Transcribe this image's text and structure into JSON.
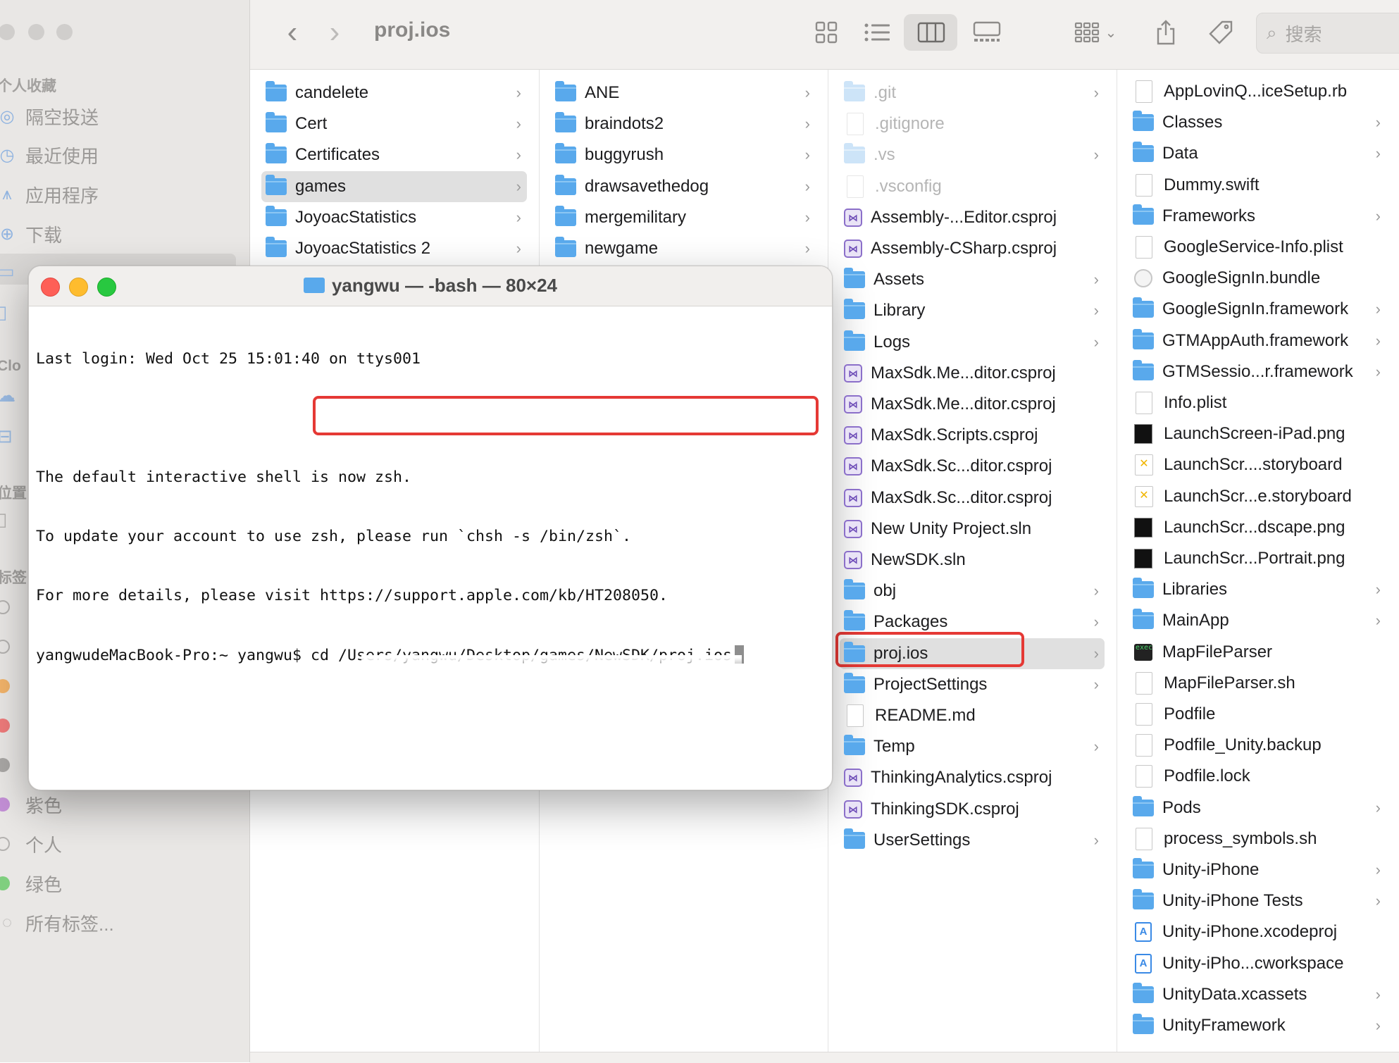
{
  "sidebar": {
    "favorites_header": "个人收藏",
    "favorites": [
      {
        "label": "隔空投送",
        "icon": "airdrop-icon"
      },
      {
        "label": "最近使用",
        "icon": "clock-icon"
      },
      {
        "label": "应用程序",
        "icon": "apps-icon"
      },
      {
        "label": "下载",
        "icon": "download-icon"
      }
    ],
    "icloud_header": "Clo",
    "locations_header": "位置",
    "tags_header": "标签",
    "tags": [
      {
        "label": "紫色",
        "color": "#c38fd6"
      },
      {
        "label": "个人",
        "color": ""
      },
      {
        "label": "绿色",
        "color": "#7fcf7f"
      },
      {
        "label": "所有标签...",
        "color": ""
      }
    ]
  },
  "toolbar": {
    "title": "proj.ios",
    "back": "‹",
    "forward": "›",
    "search_placeholder": "搜索"
  },
  "columns": [
    {
      "items": [
        {
          "name": "candelete",
          "type": "folder",
          "chevron": true
        },
        {
          "name": "Cert",
          "type": "folder",
          "chevron": true
        },
        {
          "name": "Certificates",
          "type": "folder",
          "chevron": true
        },
        {
          "name": "games",
          "type": "folder",
          "chevron": true,
          "selected": true
        },
        {
          "name": "JoyoacStatistics",
          "type": "folder",
          "chevron": true
        },
        {
          "name": "JoyoacStatistics 2",
          "type": "folder",
          "chevron": true
        }
      ]
    },
    {
      "items": [
        {
          "name": "ANE",
          "type": "folder",
          "chevron": true
        },
        {
          "name": "braindots2",
          "type": "folder",
          "chevron": true
        },
        {
          "name": "buggyrush",
          "type": "folder",
          "chevron": true
        },
        {
          "name": "drawsavethedog",
          "type": "folder",
          "chevron": true
        },
        {
          "name": "mergemilitary",
          "type": "folder",
          "chevron": true
        },
        {
          "name": "newgame",
          "type": "folder",
          "chevron": true
        }
      ]
    },
    {
      "items": [
        {
          "name": ".git",
          "type": "folder-faded",
          "chevron": true
        },
        {
          "name": ".gitignore",
          "type": "doc-faded",
          "chevron": false
        },
        {
          "name": ".vs",
          "type": "folder-faded",
          "chevron": true
        },
        {
          "name": ".vsconfig",
          "type": "doc-faded",
          "chevron": false
        },
        {
          "name": "Assembly-...Editor.csproj",
          "type": "vs",
          "chevron": false
        },
        {
          "name": "Assembly-CSharp.csproj",
          "type": "vs",
          "chevron": false
        },
        {
          "name": "Assets",
          "type": "folder",
          "chevron": true
        },
        {
          "name": "Library",
          "type": "folder",
          "chevron": true
        },
        {
          "name": "Logs",
          "type": "folder",
          "chevron": true
        },
        {
          "name": "MaxSdk.Me...ditor.csproj",
          "type": "vs",
          "chevron": false
        },
        {
          "name": "MaxSdk.Me...ditor.csproj",
          "type": "vs",
          "chevron": false
        },
        {
          "name": "MaxSdk.Scripts.csproj",
          "type": "vs",
          "chevron": false
        },
        {
          "name": "MaxSdk.Sc...ditor.csproj",
          "type": "vs",
          "chevron": false
        },
        {
          "name": "MaxSdk.Sc...ditor.csproj",
          "type": "vs",
          "chevron": false
        },
        {
          "name": "New Unity Project.sln",
          "type": "vs",
          "chevron": false
        },
        {
          "name": "NewSDK.sln",
          "type": "vs",
          "chevron": false
        },
        {
          "name": "obj",
          "type": "folder",
          "chevron": true
        },
        {
          "name": "Packages",
          "type": "folder",
          "chevron": true
        },
        {
          "name": "proj.ios",
          "type": "folder",
          "chevron": true,
          "selected": true
        },
        {
          "name": "ProjectSettings",
          "type": "folder",
          "chevron": true
        },
        {
          "name": "README.md",
          "type": "doc",
          "chevron": false
        },
        {
          "name": "Temp",
          "type": "folder",
          "chevron": true
        },
        {
          "name": "ThinkingAnalytics.csproj",
          "type": "vs",
          "chevron": false
        },
        {
          "name": "ThinkingSDK.csproj",
          "type": "vs",
          "chevron": false
        },
        {
          "name": "UserSettings",
          "type": "folder",
          "chevron": true
        }
      ]
    },
    {
      "items": [
        {
          "name": "AppLovinQ...iceSetup.rb",
          "type": "doc",
          "chevron": false
        },
        {
          "name": "Classes",
          "type": "folder",
          "chevron": true
        },
        {
          "name": "Data",
          "type": "folder",
          "chevron": true
        },
        {
          "name": "Dummy.swift",
          "type": "doc",
          "chevron": false
        },
        {
          "name": "Frameworks",
          "type": "folder",
          "chevron": true
        },
        {
          "name": "GoogleService-Info.plist",
          "type": "doc",
          "chevron": false
        },
        {
          "name": "GoogleSignIn.bundle",
          "type": "bundle",
          "chevron": false
        },
        {
          "name": "GoogleSignIn.framework",
          "type": "folder",
          "chevron": true
        },
        {
          "name": "GTMAppAuth.framework",
          "type": "folder",
          "chevron": true
        },
        {
          "name": "GTMSessio...r.framework",
          "type": "folder",
          "chevron": true
        },
        {
          "name": "Info.plist",
          "type": "doc",
          "chevron": false
        },
        {
          "name": "LaunchScreen-iPad.png",
          "type": "img",
          "chevron": false
        },
        {
          "name": "LaunchScr....storyboard",
          "type": "storyboard",
          "chevron": false
        },
        {
          "name": "LaunchScr...e.storyboard",
          "type": "storyboard",
          "chevron": false
        },
        {
          "name": "LaunchScr...dscape.png",
          "type": "img",
          "chevron": false
        },
        {
          "name": "LaunchScr...Portrait.png",
          "type": "img",
          "chevron": false
        },
        {
          "name": "Libraries",
          "type": "folder",
          "chevron": true
        },
        {
          "name": "MainApp",
          "type": "folder",
          "chevron": true
        },
        {
          "name": "MapFileParser",
          "type": "exec",
          "chevron": false
        },
        {
          "name": "MapFileParser.sh",
          "type": "doc",
          "chevron": false
        },
        {
          "name": "Podfile",
          "type": "doc",
          "chevron": false
        },
        {
          "name": "Podfile_Unity.backup",
          "type": "doc",
          "chevron": false
        },
        {
          "name": "Podfile.lock",
          "type": "doc",
          "chevron": false
        },
        {
          "name": "Pods",
          "type": "folder",
          "chevron": true
        },
        {
          "name": "process_symbols.sh",
          "type": "doc",
          "chevron": false
        },
        {
          "name": "Unity-iPhone",
          "type": "folder",
          "chevron": true
        },
        {
          "name": "Unity-iPhone Tests",
          "type": "folder",
          "chevron": true
        },
        {
          "name": "Unity-iPhone.xcodeproj",
          "type": "xcode",
          "chevron": false
        },
        {
          "name": "Unity-iPho...cworkspace",
          "type": "xcode",
          "chevron": false
        },
        {
          "name": "UnityData.xcassets",
          "type": "folder",
          "chevron": true
        },
        {
          "name": "UnityFramework",
          "type": "folder",
          "chevron": true
        }
      ]
    }
  ],
  "terminal": {
    "title": "yangwu — -bash — 80×24",
    "lines": [
      "Last login: Wed Oct 25 15:01:40 on ttys001",
      "",
      "The default interactive shell is now zsh.",
      "To update your account to use zsh, please run `chsh -s /bin/zsh`.",
      "For more details, please visit https://support.apple.com/kb/HT208050.",
      "yangwudeMacBook-Pro:~ yangwu$ cd /Users/yangwu/Desktop/games/NewSDK/proj.ios"
    ]
  },
  "colors": {
    "highlight": "#e53935",
    "folder": "#59a9ec",
    "close": "#fe5f57",
    "minimize": "#febc2e",
    "zoom": "#28c840"
  }
}
